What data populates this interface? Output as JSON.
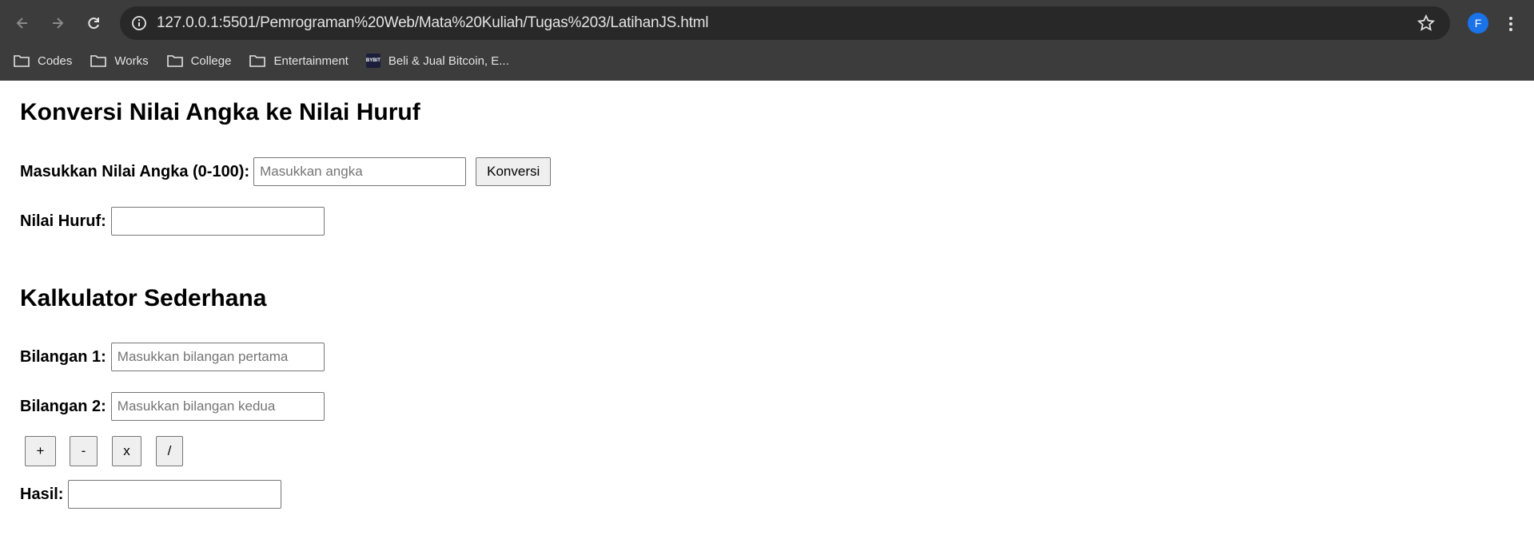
{
  "browser": {
    "url": "127.0.0.1:5501/Pemrograman%20Web/Mata%20Kuliah/Tugas%203/LatihanJS.html",
    "profile_initial": "F",
    "bookmarks": [
      "Codes",
      "Works",
      "College",
      "Entertainment",
      "Beli & Jual Bitcoin, E..."
    ],
    "bookmark_favicon_text": "BYBIT"
  },
  "converter": {
    "title": "Konversi Nilai Angka ke Nilai Huruf",
    "input_label": "Masukkan Nilai Angka (0-100):",
    "input_placeholder": "Masukkan angka",
    "convert_button": "Konversi",
    "result_label": "Nilai Huruf:"
  },
  "calculator": {
    "title": "Kalkulator Sederhana",
    "num1_label": "Bilangan 1:",
    "num1_placeholder": "Masukkan bilangan pertama",
    "num2_label": "Bilangan 2:",
    "num2_placeholder": "Masukkan bilangan kedua",
    "ops": [
      "+",
      "-",
      "x",
      "/"
    ],
    "result_label": "Hasil:"
  }
}
